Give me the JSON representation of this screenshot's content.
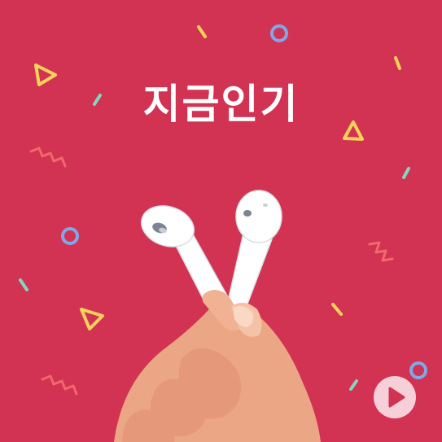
{
  "banner": {
    "title": "지금인기"
  },
  "colors": {
    "background": "#d23352",
    "title_text": "#ffffff",
    "confetti_yellow": "#f7d35a",
    "confetti_mint": "#7fd8c0",
    "confetti_blue": "#7fa8e8",
    "confetti_salmon": "#f06a6a",
    "play_button": "#f6cfd8",
    "play_icon": "#d23352"
  },
  "icons": {
    "earbuds": "wireless-earbuds-icon",
    "hand": "hand-holding-icon",
    "play": "play-icon"
  }
}
